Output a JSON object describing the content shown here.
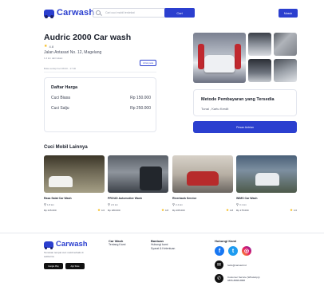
{
  "header": {
    "logo_text": "Carwash",
    "search_placeholder": "Cari cuci mobil terdekat",
    "search_button": "Cari",
    "login_button": "Masuk"
  },
  "shop": {
    "title": "Audric 2000 Car wash",
    "rating": "4.8",
    "address": "Jalan Antasari No. 12, Magelang",
    "distance": "1.2 km dari lokasi",
    "map_link": "Lihat peta",
    "hours": "Buka setiap hari 08.00 - 17.00"
  },
  "price_list": {
    "title": "Daftar Harga",
    "rows": [
      {
        "label": "Cuci Biasa",
        "price": "Rp 150.000"
      },
      {
        "label": "Cuci Salju",
        "price": "Rp 250.000"
      }
    ]
  },
  "payment": {
    "title": "Metode Pembayaran yang Tersedia",
    "methods": "Tunai , Kartu Kredit"
  },
  "book_button": "Pesan Antrian",
  "other_washes": {
    "title": "Cuci Mobil Lainnya",
    "items": [
      {
        "name": "Rasa Salat Car Wash",
        "location": "1.8 km",
        "price": "Rp 215.000",
        "rating": "4.6"
      },
      {
        "name": "PROUD Automotive Wash",
        "location": "2.0 km",
        "price": "Rp 180.000",
        "rating": "4.8"
      },
      {
        "name": "Riverbank Service",
        "location": "2.4 km",
        "price": "Rp 205.000",
        "rating": "4.8"
      },
      {
        "name": "WIMS Car Wash",
        "location": "3.1 km",
        "price": "Rp 175.000",
        "rating": "4.6"
      }
    ]
  },
  "footer": {
    "logo_text": "Carwash",
    "tagline": "Temukan tempat cuci mobil terbaik di sekitarmu",
    "store_badges": [
      "Google Play",
      "App Store"
    ],
    "col1": {
      "heading": "Car Wash",
      "item": "Tentang Kami"
    },
    "col2": {
      "heading": "Bantuan",
      "item1": "Hubungi kami",
      "item2": "Syarat & Ketentuan"
    },
    "contact_title": "Hubungi Kami",
    "email": "hello@carwash.id",
    "whatsapp_line1": "Customer Service (WhatsApp)",
    "whatsapp_line2": "0855-8888-8888"
  },
  "colors": {
    "brand": "#2b3fcf",
    "star": "#f5b400"
  }
}
